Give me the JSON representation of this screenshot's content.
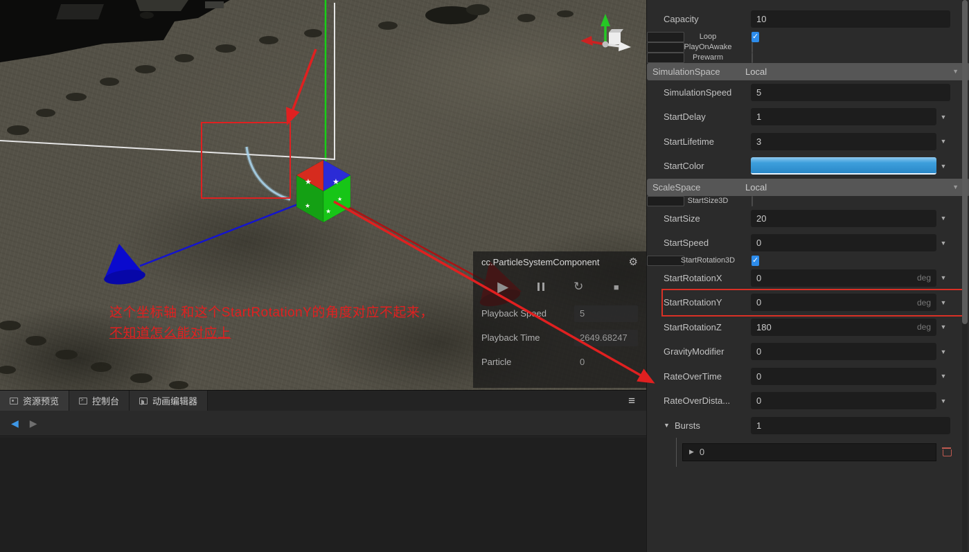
{
  "colors": {
    "annotation_red": "#e02020",
    "checkbox_checked_blue": "#2d8ceb",
    "start_color_swatch_blue": "#3d9fdc",
    "select_background": "#565656"
  },
  "scene": {
    "annotation": {
      "line1": "这个坐标轴 和这个StartRotationY的角度对应不起来，",
      "line2": "不知道怎么能对应上"
    },
    "overlay_panel": {
      "title": "cc.ParticleSystemComponent",
      "gear_icon": "gear-icon",
      "buttons": [
        "play",
        "pause",
        "restart",
        "stop"
      ],
      "fields": [
        {
          "label": "Playback Speed",
          "value": "5"
        },
        {
          "label": "Playback Time",
          "value": "2649.68247"
        },
        {
          "label": "Particle",
          "value": "0"
        }
      ]
    }
  },
  "bottom_panel": {
    "tabs": [
      {
        "label": "资源预览",
        "icon": "asset-preview-icon",
        "active": true
      },
      {
        "label": "控制台",
        "icon": "console-icon",
        "active": false
      },
      {
        "label": "动画编辑器",
        "icon": "animation-editor-icon",
        "active": false
      }
    ],
    "menu_icon_label": "≡",
    "nav": {
      "back_enabled": true,
      "forward_enabled": false
    }
  },
  "inspector": {
    "rows": [
      {
        "label": "Capacity",
        "type": "input",
        "value": "10"
      },
      {
        "label": "Loop",
        "type": "checkbox",
        "checked": true
      },
      {
        "label": "PlayOnAwake",
        "type": "checkbox",
        "checked": false
      },
      {
        "label": "Prewarm",
        "type": "checkbox",
        "checked": false
      },
      {
        "label": "SimulationSpace",
        "type": "select",
        "value": "Local"
      },
      {
        "label": "SimulationSpeed",
        "type": "input",
        "value": "5"
      },
      {
        "label": "StartDelay",
        "type": "input",
        "value": "1",
        "curve": true
      },
      {
        "label": "StartLifetime",
        "type": "input",
        "value": "3",
        "curve": true
      },
      {
        "label": "StartColor",
        "type": "color",
        "curve": true
      },
      {
        "label": "ScaleSpace",
        "type": "select",
        "value": "Local"
      },
      {
        "label": "StartSize3D",
        "type": "checkbox",
        "checked": false
      },
      {
        "label": "StartSize",
        "type": "input",
        "value": "20",
        "curve": true
      },
      {
        "label": "StartSpeed",
        "type": "input",
        "value": "0",
        "curve": true
      },
      {
        "label": "StartRotation3D",
        "type": "checkbox",
        "checked": true
      },
      {
        "label": "StartRotationX",
        "type": "input",
        "value": "0",
        "unit": "deg",
        "curve": true
      },
      {
        "label": "StartRotationY",
        "type": "input",
        "value": "0",
        "unit": "deg",
        "curve": true,
        "highlight": true
      },
      {
        "label": "StartRotationZ",
        "type": "input",
        "value": "180",
        "unit": "deg",
        "curve": true
      },
      {
        "label": "GravityModifier",
        "type": "input",
        "value": "0",
        "curve": true
      },
      {
        "label": "RateOverTime",
        "type": "input",
        "value": "0",
        "curve": true
      },
      {
        "label": "RateOverDista...",
        "type": "input",
        "value": "0",
        "curve": true
      },
      {
        "label": "Bursts",
        "type": "group",
        "value": "1"
      },
      {
        "label": "0",
        "type": "subitem"
      }
    ]
  }
}
